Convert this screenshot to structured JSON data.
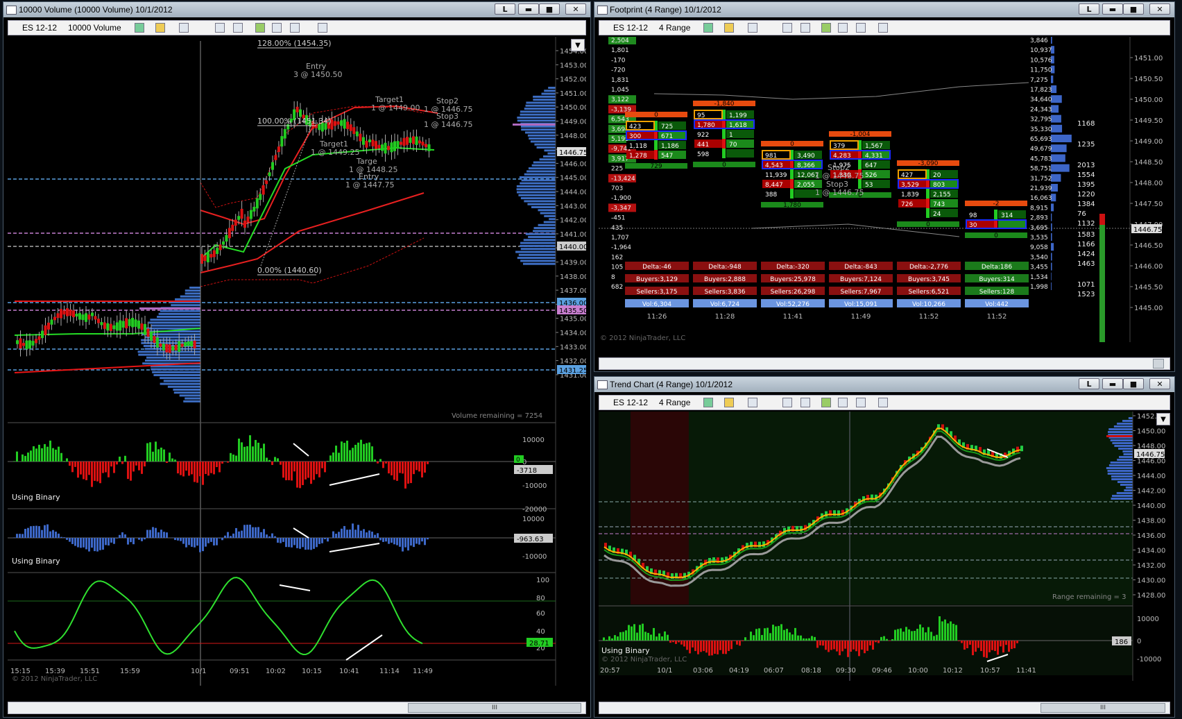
{
  "window_left": {
    "title": "10000 Volume (10000 Volume)  10/1/2012",
    "instrument": "ES 12-12",
    "period": "10000 Volume",
    "price_labels": [
      "1454.00",
      "1453.00",
      "1452.00",
      "1451.00",
      "1450.00",
      "1449.00",
      "1448.00",
      "1447.00",
      "1446.00",
      "1445.00",
      "1444.00",
      "1443.00",
      "1442.00",
      "1441.00",
      "1440.00",
      "1439.00",
      "1438.00",
      "1437.00",
      "1436.00",
      "1435.00",
      "1434.00",
      "1433.00",
      "1432.00",
      "1431.00"
    ],
    "last_price": "1446.75",
    "level_1440": "1440.00",
    "level_1436": "1436.00",
    "level_1435": "1435.50",
    "level_1431": "1431.25",
    "fib_128": "128.00% (1454.35)",
    "fib_100": "100.00% (1451.34)",
    "fib_0": "0.00% (1440.60)",
    "entry_label": "Entry",
    "entry_value": "3 @ 1450.50",
    "target1_a": "Target1",
    "target1_a_val": "1 @ 1449.00",
    "stop2": "Stop2",
    "stop2_val": "1 @ 1446.75",
    "stop3": "Stop3",
    "stop3_val": "1 @ 1446.75",
    "target1_b": "Target1",
    "target1_b_val": "1 @ 1449.25",
    "target_c": "Targe",
    "target_c_val": "1 @ 1448.25",
    "entry_b": "Entry",
    "entry_b_val": "1 @ 1447.75",
    "volume_remaining": "Volume remaining = 7254",
    "panel2_label": "Using Binary",
    "panel2_axis": [
      "10000",
      "0",
      "-10000",
      "-20000"
    ],
    "panel2_value": "-3718",
    "panel2_zero": "0",
    "panel3_label": "Using Binary",
    "panel3_axis": [
      "10000",
      "0",
      "-10000"
    ],
    "panel3_value": "-963.63",
    "panel4_axis": [
      "100",
      "80",
      "60",
      "40",
      "20"
    ],
    "panel4_value": "28.71",
    "copyright": "© 2012 NinjaTrader, LLC",
    "time_labels": [
      "15:15",
      "15:39",
      "15:51",
      "15:59",
      "10/1",
      "09:51",
      "10:02",
      "10:15",
      "10:41",
      "11:14",
      "11:49"
    ]
  },
  "window_footprint": {
    "title": "Footprint (4 Range)  10/1/2012",
    "instrument": "ES 12-12",
    "period": "4 Range",
    "price_labels": [
      "1451.00",
      "1450.50",
      "1450.00",
      "1449.50",
      "1449.00",
      "1448.50",
      "1448.00",
      "1447.50",
      "1447.00",
      "1446.50",
      "1446.00",
      "1445.50",
      "1445.00"
    ],
    "last_price": "1446.75",
    "left_deltas": [
      "2,504",
      "1,801",
      "-170",
      "-720",
      "1,831",
      "1,045",
      "3,122",
      "-3,139",
      "6,543",
      "3,694",
      "5,199",
      "-9,741",
      "3,917",
      "225",
      "-13,424",
      "703",
      "-1,900",
      "-3,347",
      "-451",
      "435",
      "1,707",
      "-1,964",
      "162",
      "105",
      "8",
      "682"
    ],
    "right_vols": [
      "3,846",
      "10,937",
      "10,576",
      "11,750",
      "7,275",
      "17,823",
      "34,640",
      "24,343",
      "32,795",
      "35,330",
      "65,693",
      "49,679",
      "45,783",
      "58,751",
      "31,752",
      "21,939",
      "16,063",
      "8,915",
      "2,893",
      "3,695",
      "3,535",
      "9,058",
      "3,540",
      "3,455",
      "1,534",
      "1,998"
    ],
    "right_counts": [
      "1168",
      "1235",
      "2013",
      "1554",
      "1395",
      "1220",
      "1384",
      "76",
      "1132",
      "1583",
      "1166",
      "1424",
      "1463",
      "1071",
      "1523"
    ],
    "bars": [
      {
        "time": "11:26",
        "delta": "Delta:-46",
        "buyers": "Buyers:3,129",
        "sellers": "Sellers:3,175",
        "vol": "Vol:6,304",
        "top": "0",
        "bot": "729"
      },
      {
        "time": "11:28",
        "delta": "Delta:-948",
        "buyers": "Buyers:2,888",
        "sellers": "Sellers:3,836",
        "vol": "Vol:6,724",
        "top": "-1,840",
        "bot": "0"
      },
      {
        "time": "11:41",
        "delta": "Delta:-320",
        "buyers": "Buyers:25,978",
        "sellers": "Sellers:26,298",
        "vol": "Vol:52,276",
        "top": "0",
        "bot": "1,780"
      },
      {
        "time": "11:49",
        "delta": "Delta:-843",
        "buyers": "Buyers:7,124",
        "sellers": "Sellers:7,967",
        "vol": "Vol:15,091",
        "top": "-1,004",
        "bot": "0"
      },
      {
        "time": "11:52",
        "delta": "Delta:-2,776",
        "buyers": "Buyers:3,745",
        "sellers": "Sellers:6,521",
        "vol": "Vol:10,266",
        "top": "-3,090",
        "bot": "0"
      },
      {
        "time": "11:52",
        "delta": "Delta:186",
        "buyers": "Buyers:314",
        "sellers": "Sellers:128",
        "vol": "Vol:442",
        "top": "-2",
        "bot": "0"
      }
    ],
    "cells": {
      "b1": [
        [
          "423",
          "725"
        ],
        [
          "300",
          "671"
        ],
        [
          "1,118",
          "1,186"
        ],
        [
          "1,278",
          "547"
        ]
      ],
      "b2": [
        [
          "95",
          "1,199"
        ],
        [
          "1,780",
          "1,618"
        ],
        [
          "922",
          "1"
        ],
        [
          "441",
          "70"
        ],
        [
          "598",
          ""
        ]
      ],
      "b3": [
        [
          "981",
          "3,490"
        ],
        [
          "4,543",
          "8,366"
        ],
        [
          "11,939",
          "12,067"
        ],
        [
          "8,447",
          "2,055"
        ],
        [
          "388",
          ""
        ]
      ],
      "b4": [
        [
          "379",
          "1,567"
        ],
        [
          "4,283",
          "4,331"
        ],
        [
          "1,975",
          "647"
        ],
        [
          "1,330",
          "526"
        ],
        [
          "",
          "53"
        ]
      ],
      "b5": [
        [
          "427",
          "20"
        ],
        [
          "3,529",
          "803"
        ],
        [
          "1,839",
          "2,155"
        ],
        [
          "726",
          "743"
        ],
        [
          "",
          "24"
        ]
      ],
      "b6": [
        [
          "98",
          "314"
        ],
        [
          "30",
          ""
        ]
      ]
    },
    "stop2": "Stop2",
    "stop2_val": "1 @ 1446.75",
    "stop3": "Stop3",
    "stop3_val": "1 @ 1446.75",
    "copyright": "© 2012 NinjaTrader, LLC"
  },
  "window_trend": {
    "title": "Trend Chart (4 Range)  10/1/2012",
    "instrument": "ES 12-12",
    "period": "4 Range",
    "price_labels": [
      "1452.00",
      "1450.00",
      "1448.00",
      "1446.00",
      "1444.00",
      "1442.00",
      "1440.00",
      "1438.00",
      "1436.00",
      "1434.00",
      "1432.00",
      "1430.00",
      "1428.00"
    ],
    "last_price": "1446.75",
    "range_remaining": "Range remaining = 3",
    "osc_axis": [
      "10000",
      "0",
      "-10000"
    ],
    "osc_value": "186",
    "osc_label": "Using Binary",
    "copyright": "© 2012 NinjaTrader, LLC",
    "time_labels": [
      "20:57",
      "10/1",
      "03:06",
      "04:19",
      "06:07",
      "08:18",
      "09:30",
      "09:46",
      "10:00",
      "10:12",
      "10:57",
      "11:41"
    ]
  },
  "buttons": {
    "link": "L",
    "min": "▬",
    "max": "■",
    "close": "✕",
    "scroll_grip": "III",
    "dropdown": "▼"
  },
  "colors": {
    "up": "#22cc22",
    "down": "#dd1111",
    "accent": "#5aa0e0",
    "bg": "#000000"
  }
}
